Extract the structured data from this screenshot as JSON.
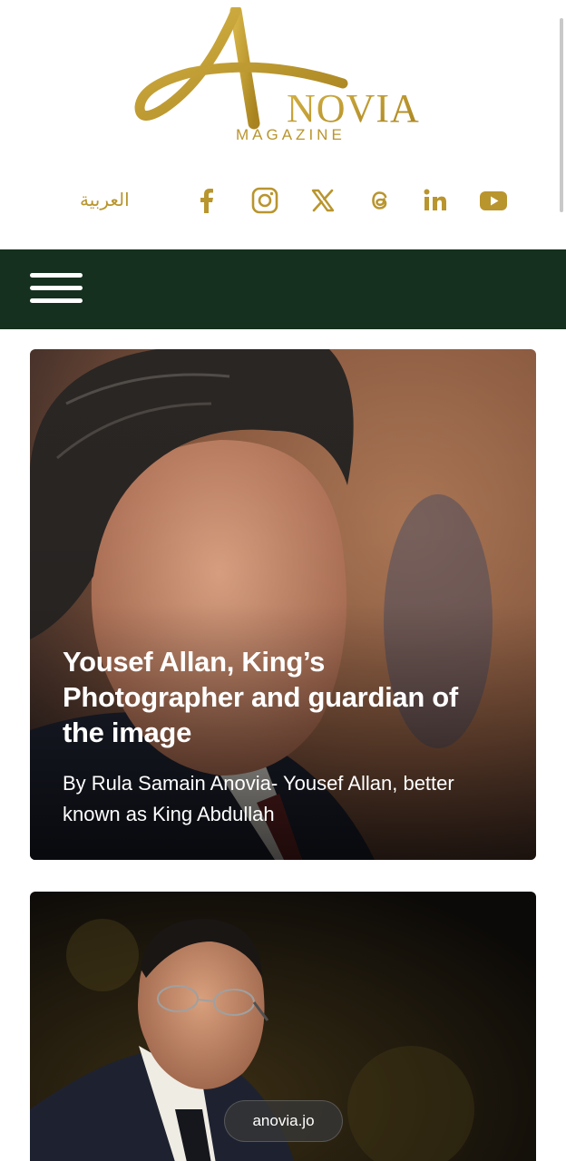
{
  "brand": {
    "logo_letter": "A",
    "logo_word": "NOVIA",
    "logo_sub": "MAGAZINE",
    "gold": "#b9952e"
  },
  "header": {
    "arabic_link": "العربية",
    "social_icons": [
      "facebook-icon",
      "instagram-icon",
      "x-icon",
      "threads-icon",
      "linkedin-icon",
      "youtube-icon"
    ]
  },
  "nav": {
    "bg_color": "#15301e",
    "menu_icon": "hamburger-menu-icon"
  },
  "articles": [
    {
      "title": "Yousef Allan, King’s Photographer and guardian of the image",
      "excerpt": "By Rula Samain Anovia-  Yousef Allan, better known as King Abdullah"
    },
    {
      "title": "",
      "excerpt": ""
    }
  ],
  "browser": {
    "url": "anovia.jo"
  }
}
